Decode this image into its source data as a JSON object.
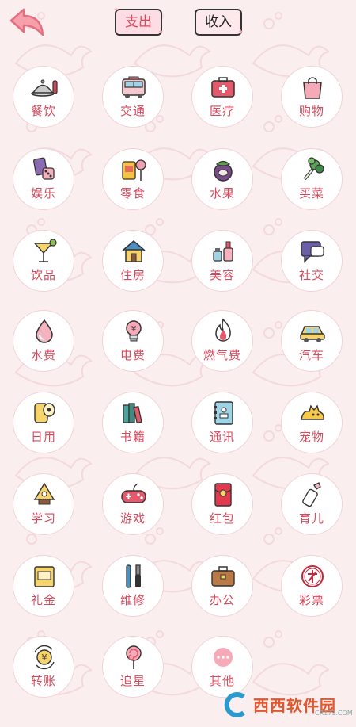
{
  "header": {
    "tabs": [
      {
        "label": "支出",
        "active": true
      },
      {
        "label": "收入",
        "active": false
      }
    ]
  },
  "categories": [
    {
      "label": "餐饮",
      "icon": "dining-icon"
    },
    {
      "label": "交通",
      "icon": "bus-icon"
    },
    {
      "label": "医疗",
      "icon": "medical-kit-icon"
    },
    {
      "label": "购物",
      "icon": "shopping-bag-icon"
    },
    {
      "label": "娱乐",
      "icon": "dice-cards-icon"
    },
    {
      "label": "零食",
      "icon": "snack-lollipop-icon"
    },
    {
      "label": "水果",
      "icon": "mangosteen-icon"
    },
    {
      "label": "买菜",
      "icon": "vegetable-icon"
    },
    {
      "label": "饮品",
      "icon": "cocktail-icon"
    },
    {
      "label": "住房",
      "icon": "house-icon"
    },
    {
      "label": "美容",
      "icon": "cosmetics-icon"
    },
    {
      "label": "社交",
      "icon": "chat-icon"
    },
    {
      "label": "水费",
      "icon": "water-drop-icon"
    },
    {
      "label": "电费",
      "icon": "lightbulb-icon"
    },
    {
      "label": "燃气费",
      "icon": "flame-icon"
    },
    {
      "label": "汽车",
      "icon": "car-icon"
    },
    {
      "label": "日用",
      "icon": "toilet-paper-icon"
    },
    {
      "label": "书籍",
      "icon": "books-icon"
    },
    {
      "label": "通讯",
      "icon": "address-book-icon"
    },
    {
      "label": "宠物",
      "icon": "pet-cat-icon"
    },
    {
      "label": "学习",
      "icon": "graduation-icon"
    },
    {
      "label": "游戏",
      "icon": "gamepad-icon"
    },
    {
      "label": "红包",
      "icon": "red-envelope-icon"
    },
    {
      "label": "育儿",
      "icon": "baby-bottle-icon"
    },
    {
      "label": "礼金",
      "icon": "gift-money-icon"
    },
    {
      "label": "维修",
      "icon": "tools-icon"
    },
    {
      "label": "办公",
      "icon": "briefcase-icon"
    },
    {
      "label": "彩票",
      "icon": "lottery-icon"
    },
    {
      "label": "转账",
      "icon": "transfer-icon"
    },
    {
      "label": "追星",
      "icon": "lollipop-icon"
    },
    {
      "label": "其他",
      "icon": "more-icon"
    }
  ],
  "watermark": {
    "text": "西西软件园",
    "sub": "CR173.COM"
  }
}
